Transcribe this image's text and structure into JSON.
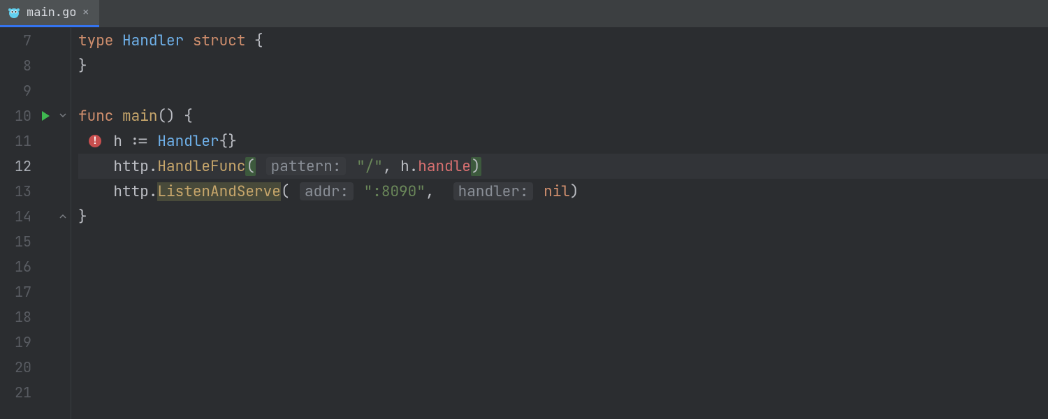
{
  "tab": {
    "filename": "main.go",
    "close_glyph": "×"
  },
  "lines": [
    {
      "n": 7
    },
    {
      "n": 8
    },
    {
      "n": 9
    },
    {
      "n": 10,
      "run": true,
      "fold": "open"
    },
    {
      "n": 11,
      "error": true
    },
    {
      "n": 12,
      "current": true
    },
    {
      "n": 13
    },
    {
      "n": 14,
      "fold": "close"
    },
    {
      "n": 15
    },
    {
      "n": 16
    },
    {
      "n": 17
    },
    {
      "n": 18
    },
    {
      "n": 19
    },
    {
      "n": 20
    },
    {
      "n": 21
    }
  ],
  "code": {
    "l7": {
      "kw1": "type",
      "typ": "Handler",
      "kw2": "struct",
      "brace": " {"
    },
    "l8": {
      "txt": "}"
    },
    "l10": {
      "kw": "func",
      "fn": "main",
      "rest": "() {"
    },
    "l11": {
      "indent": "    ",
      "txt1": "h := ",
      "typ": "Handler",
      "txt2": "{}"
    },
    "l12": {
      "indent": "    ",
      "pkg": "http",
      "dot": ".",
      "fn": "HandleFunc",
      "hint1": "pattern:",
      "arg1": "\"/\"",
      "comma1": ", ",
      "recv": "h",
      "dot2": ".",
      "meth": "handle"
    },
    "l13": {
      "indent": "    ",
      "pkg": "http",
      "dot": ".",
      "fn": "ListenAndServe",
      "open": "(",
      "hint1": "addr:",
      "arg1": "\":8090\"",
      "comma1": ", ",
      "hint2": "handler:",
      "arg2": "nil",
      "close": ")"
    },
    "l14": {
      "txt": "}"
    }
  },
  "error_badge_glyph": "!"
}
